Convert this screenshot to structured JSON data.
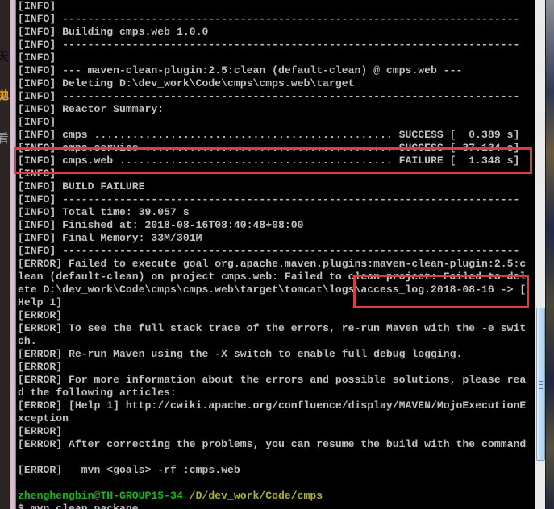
{
  "left_strip": {
    "glyphs": [
      {
        "char": "天",
        "color": "#c06a3a"
      },
      {
        "char": "拋",
        "color": "#e8a020"
      },
      {
        "char": "看",
        "color": "#a0a0a0"
      }
    ]
  },
  "terminal": {
    "lines": [
      "[INFO]",
      "[INFO] ------------------------------------------------------------------------",
      "[INFO] Building cmps.web 1.0.0",
      "[INFO] ------------------------------------------------------------------------",
      "[INFO]",
      "[INFO] --- maven-clean-plugin:2.5:clean (default-clean) @ cmps.web ---",
      "[INFO] Deleting D:\\dev_work\\Code\\cmps\\cmps.web\\target",
      "[INFO] ------------------------------------------------------------------------",
      "[INFO] Reactor Summary:",
      "[INFO]",
      "[INFO] cmps ............................................... SUCCESS [  0.389 s]",
      "[INFO] cmps.service ....................................... SUCCESS [ 37.134 s]",
      "[INFO] cmps.web ........................................... FAILURE [  1.348 s]",
      "[INFO]",
      "[INFO] BUILD FAILURE",
      "[INFO] ------------------------------------------------------------------------",
      "[INFO] Total time: 39.057 s",
      "[INFO] Finished at: 2018-08-16T08:40:48+08:00",
      "[INFO] Final Memory: 33M/301M",
      "[INFO] ------------------------------------------------------------------------",
      "[ERROR] Failed to execute goal org.apache.maven.plugins:maven-clean-plugin:2.5:c",
      "lean (default-clean) on project cmps.web: Failed to clean project: Failed to del",
      "ete D:\\dev_work\\Code\\cmps\\cmps.web\\target\\tomcat\\logs\\access_log.2018-08-16 -> [",
      "Help 1]",
      "[ERROR]",
      "[ERROR] To see the full stack trace of the errors, re-run Maven with the -e swit",
      "ch.",
      "[ERROR] Re-run Maven using the -X switch to enable full debug logging.",
      "[ERROR]",
      "[ERROR] For more information about the errors and possible solutions, please rea",
      "d the following articles:",
      "[ERROR] [Help 1] http://cwiki.apache.org/confluence/display/MAVEN/MojoExecutionE",
      "xception",
      "[ERROR]",
      "[ERROR] After correcting the problems, you can resume the build with the command",
      "",
      "[ERROR]   mvn <goals> -rf :cmps.web",
      ""
    ],
    "prompt": {
      "user_host": "zhenghengbin@TH-GROUP15-34",
      "path": "/D/dev_work/Code/cmps"
    },
    "command_line": "$ mvn clean package"
  },
  "annotations": [
    {
      "label": "cmps.web FAILURE highlight",
      "color": "#e23b3b"
    },
    {
      "label": "access_log file highlight",
      "color": "#e23b3b"
    }
  ],
  "colors": {
    "text": "#c0c0c0",
    "prompt_user": "#15b915",
    "prompt_path": "#b0b030",
    "annotation": "#e23b3b"
  }
}
